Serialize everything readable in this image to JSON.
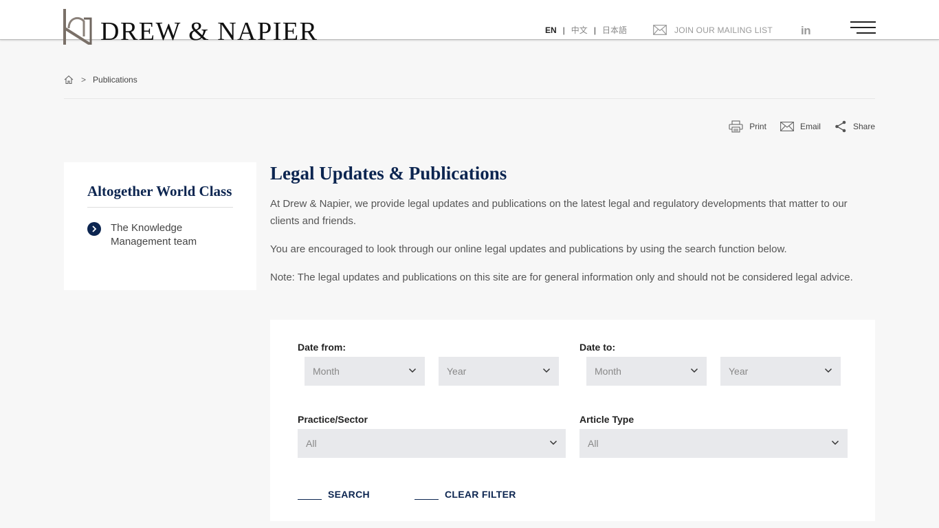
{
  "header": {
    "logo_text": "DREW & NAPIER",
    "languages": [
      {
        "label": "EN",
        "active": true
      },
      {
        "label": "中文",
        "active": false
      },
      {
        "label": "日本語",
        "active": false
      }
    ],
    "mailing_label": "JOIN OUR MAILING LIST",
    "linkedin_label": "in",
    "icons": {
      "mail": "mail-icon",
      "linkedin": "linkedin-icon",
      "menu": "menu-icon"
    }
  },
  "breadcrumb": {
    "separator": ">",
    "current": "Publications"
  },
  "tools": {
    "print": "Print",
    "email": "Email",
    "share": "Share"
  },
  "sidebar": {
    "heading": "Altogether World Class",
    "item_label": "The Knowledge Management team"
  },
  "main": {
    "title": "Legal Updates & Publications",
    "paragraphs": [
      "At Drew & Napier, we provide legal updates and publications on the latest legal and regulatory developments that matter to our clients and friends.",
      "You are encouraged to look through our online legal updates and publications by using the search function below.",
      "Note: The legal updates and publications on this site are for general information only and should not be considered legal advice."
    ]
  },
  "filters": {
    "date_from_label": "Date from:",
    "date_to_label": "Date to:",
    "from_month": "Month",
    "from_year": "Year",
    "to_month": "Month",
    "to_year": "Year",
    "practice_label": "Practice/Sector",
    "practice_value": "All",
    "article_label": "Article Type",
    "article_value": "All",
    "search_label": "SEARCH",
    "clear_label": "CLEAR FILTER"
  },
  "colors": {
    "brand_navy": "#0c2550",
    "select_bg": "#e8e9ec",
    "page_bg": "#f7f7f7"
  }
}
